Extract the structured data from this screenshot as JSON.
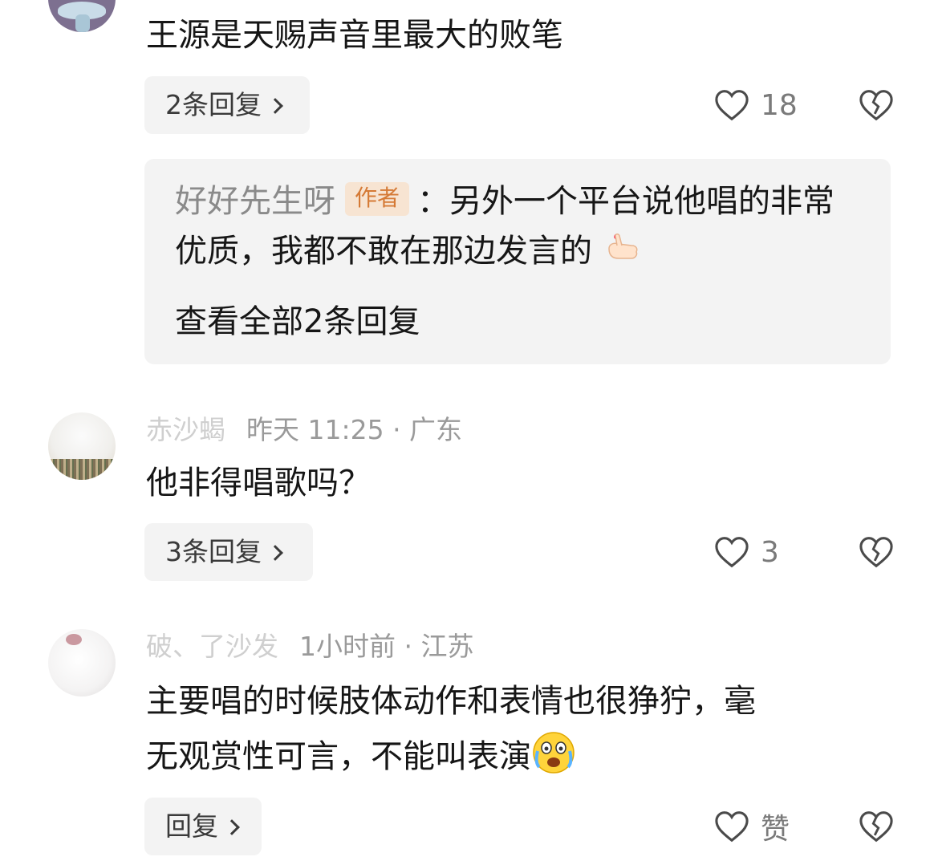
{
  "comments": [
    {
      "text": "王源是天赐声音里最大的败笔",
      "reply_button": "2条回复",
      "likes": "18",
      "sub_reply": {
        "author": "好好先生呀",
        "badge": "作者",
        "line1": "：另外一个平台说他唱的非常",
        "line2": "优质，我都不敢在那边发言的",
        "line2_emoji": "finger-heart-emoji",
        "view_all": "查看全部2条回复"
      }
    },
    {
      "author": "赤沙蝎",
      "meta": "昨天 11:25 · 广东",
      "text": "他非得唱歌吗？",
      "reply_button": "3条回复",
      "likes": "3"
    },
    {
      "author": "破、了沙发",
      "meta": "1小时前 · 江苏",
      "text_line1": "主要唱的时候肢体动作和表情也很狰狞，毫",
      "text_line2": "无观赏性可言，不能叫表演",
      "text_emoji": "crying-face-emoji",
      "reply_button": "回复",
      "likes": "赞"
    }
  ],
  "icons": {
    "like": "heart-outline-icon",
    "dislike": "broken-heart-icon",
    "chevron": "chevron-right-icon"
  },
  "colors": {
    "badge_bg": "#f7e4d2",
    "badge_text": "#d57a36",
    "muted": "#9a9a9a",
    "pill_bg": "#f3f3f3"
  }
}
